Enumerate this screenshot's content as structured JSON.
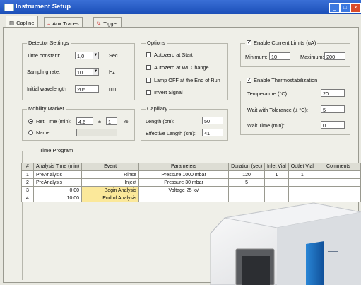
{
  "window": {
    "title": "Instrument Setup"
  },
  "tabs": [
    {
      "label": "Capline",
      "active": true
    },
    {
      "label": "Aux Traces",
      "active": false
    },
    {
      "label": "Tigger",
      "active": false
    }
  ],
  "detector": {
    "title": "Detector Settings",
    "time_constant_label": "Time constant:",
    "time_constant_value": "1,0",
    "time_constant_unit": "Sec",
    "sampling_rate_label": "Sampling rate:",
    "sampling_rate_value": "10",
    "sampling_rate_unit": "Hz",
    "wavelength_label": "Initial wavelength",
    "wavelength_value": "205",
    "wavelength_unit": "nm"
  },
  "mobility": {
    "title": "Mobility Marker",
    "ret_time_label": "Ret.Time (min):",
    "ret_time_value": "4,6",
    "pm_sign": "±",
    "tolerance_value": "1",
    "percent": "%",
    "name_label": "Name",
    "name_value": ""
  },
  "options": {
    "title": "Options",
    "items": [
      "Autozero at Start",
      "Autozero at WL Change",
      "Lamp OFF at the End of Run",
      "Invert Signal"
    ]
  },
  "capillary": {
    "title": "Capillary",
    "length_label": "Length (cm):",
    "length_value": "50",
    "eff_length_label": "Effective Length (cm):",
    "eff_length_value": "41"
  },
  "current_limits": {
    "title": "Enable Current Limits (uA)",
    "min_label": "Minimum:",
    "min_value": "10",
    "max_label": "Maximum:",
    "max_value": "200"
  },
  "thermo": {
    "title": "Enable Thermostabilization",
    "temp_label": "Temperature (°C) :",
    "temp_value": "20",
    "tol_label": "Wait with Tolerance (± °C):",
    "tol_value": "5",
    "wait_label": "Wait Time (min):",
    "wait_value": "0"
  },
  "time_program": {
    "title": "Time Program",
    "columns": [
      "#",
      "Analysis Time (min)",
      "Event",
      "Parameters",
      "Duration (sec)",
      "Inlet Vial",
      "Outlet Vial",
      "Comments"
    ],
    "rows": [
      {
        "n": "1",
        "time": "PreAnalysis",
        "event": "Rinse",
        "params": "Pressure 1000 mbar",
        "duration": "120",
        "inlet": "1",
        "outlet": "1"
      },
      {
        "n": "2",
        "time": "PreAnalysis",
        "event": "Inject",
        "params": "Pressure 30 mbar",
        "duration": "5",
        "inlet": "",
        "outlet": ""
      },
      {
        "n": "3",
        "time": "0,00",
        "event": "Begin Analysis",
        "params": "Voltage 25 kV",
        "duration": "",
        "inlet": "",
        "outlet": ""
      },
      {
        "n": "4",
        "time": "10,00",
        "event": "End of Analysis",
        "params": "",
        "duration": "",
        "inlet": "",
        "outlet": ""
      }
    ]
  },
  "colors": {
    "titlebar": "#1b4fb8",
    "event_highlight": "#fbe89a",
    "instrument_blue": "#1f6fb8"
  }
}
